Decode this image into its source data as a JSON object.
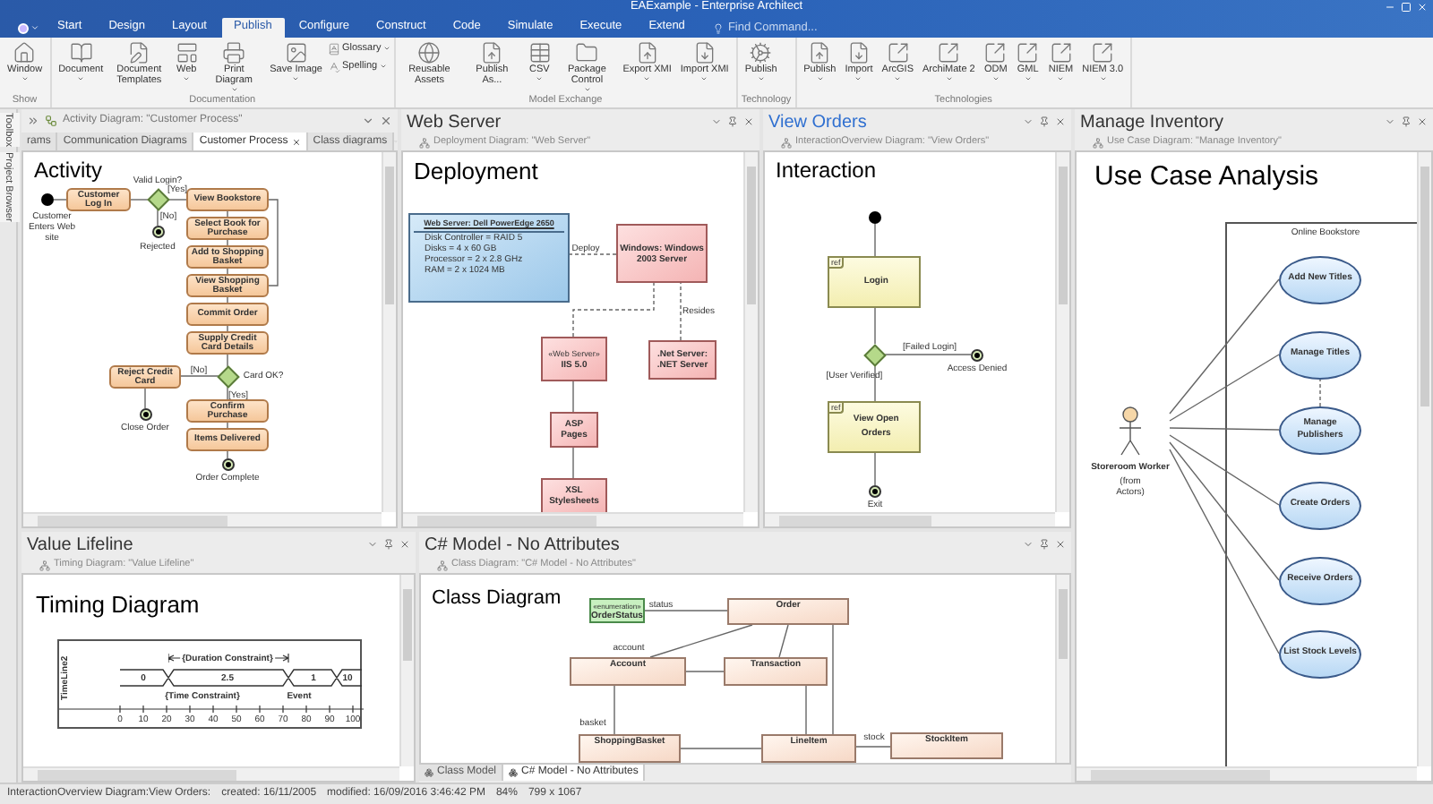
{
  "window": {
    "title": "EAExample - Enterprise Architect"
  },
  "ribbon_tabs": [
    {
      "label": "Start",
      "selected": false
    },
    {
      "label": "Design",
      "selected": false
    },
    {
      "label": "Layout",
      "selected": false
    },
    {
      "label": "Publish",
      "selected": true
    },
    {
      "label": "Configure",
      "selected": false
    },
    {
      "label": "Construct",
      "selected": false
    },
    {
      "label": "Code",
      "selected": false
    },
    {
      "label": "Simulate",
      "selected": false
    },
    {
      "label": "Execute",
      "selected": false
    },
    {
      "label": "Extend",
      "selected": false
    }
  ],
  "find_command": {
    "placeholder": "Find Command..."
  },
  "ribbon_groups": [
    {
      "label": "Show",
      "buttons": [
        {
          "kind": "large",
          "label": "Window",
          "dropdown": true
        }
      ]
    },
    {
      "label": "Documentation",
      "buttons": [
        {
          "kind": "large",
          "label": "Document",
          "dropdown": true
        },
        {
          "kind": "large",
          "label": "Document Templates",
          "dropdown": false
        },
        {
          "kind": "large",
          "label": "Web",
          "dropdown": true
        },
        {
          "kind": "large",
          "label": "Print Diagram",
          "dropdown": true
        },
        {
          "kind": "large",
          "label": "Save Image",
          "dropdown": true
        },
        {
          "kind": "small",
          "label": "Glossary",
          "dropdown": true
        },
        {
          "kind": "small",
          "label": "Spelling",
          "dropdown": true
        }
      ]
    },
    {
      "label": "Model Exchange",
      "buttons": [
        {
          "kind": "large",
          "label": "Reusable Assets",
          "dropdown": false
        },
        {
          "kind": "large",
          "label": "Publish As...",
          "dropdown": false
        },
        {
          "kind": "large",
          "label": "CSV",
          "dropdown": true
        },
        {
          "kind": "large",
          "label": "Package Control",
          "dropdown": true
        },
        {
          "kind": "large",
          "label": "Export XMI",
          "dropdown": true
        },
        {
          "kind": "large",
          "label": "Import XMI",
          "dropdown": true
        }
      ]
    },
    {
      "label": "Technology",
      "buttons": [
        {
          "kind": "large",
          "label": "Publish",
          "dropdown": true
        }
      ]
    },
    {
      "label": "Technologies",
      "buttons": [
        {
          "kind": "large",
          "label": "Publish",
          "dropdown": true
        },
        {
          "kind": "large",
          "label": "Import",
          "dropdown": true
        },
        {
          "kind": "large",
          "label": "ArcGIS",
          "dropdown": true
        },
        {
          "kind": "large",
          "label": "ArchiMate 2",
          "dropdown": true
        },
        {
          "kind": "large",
          "label": "ODM",
          "dropdown": true
        },
        {
          "kind": "large",
          "label": "GML",
          "dropdown": true
        },
        {
          "kind": "large",
          "label": "NIEM",
          "dropdown": true
        },
        {
          "kind": "large",
          "label": "NIEM 3.0",
          "dropdown": true
        }
      ]
    }
  ],
  "side_tabs": [
    "Toolbox",
    "Project Browser"
  ],
  "panels": [
    {
      "kind": "tabbed",
      "caption": "Activity Diagram: \"Customer Process\"",
      "tabs": [
        {
          "label": "rams",
          "selected": false
        },
        {
          "label": "Communication Diagrams",
          "selected": false
        },
        {
          "label": "Customer Process",
          "selected": true
        },
        {
          "label": "Class diagrams",
          "selected": false
        }
      ],
      "diagram": {
        "kind": "activity",
        "heading": "Activity",
        "actions": [
          "Customer Log In",
          "View Bookstore",
          "Select Book for Purchase",
          "Add to Shopping Basket",
          "View Shopping Basket",
          "Commit Order",
          "Supply Credit Card Details",
          "Reject Credit Card",
          "Confirm Purchase",
          "Items Delivered"
        ],
        "labels": [
          "Customer Enters Web site",
          "Valid Login?",
          "[Yes]",
          "[No]",
          "Rejected",
          "[No]",
          "Card OK?",
          "[Yes]",
          "Close Order",
          "Order Complete"
        ]
      }
    },
    {
      "kind": "titled",
      "title": "Web Server",
      "active": false,
      "caption": "Deployment Diagram: \"Web Server\"",
      "diagram": {
        "kind": "deployment",
        "heading": "Deployment",
        "nodes": [
          {
            "kind": "device",
            "label": "Web Server: Dell PowerEdge 2650",
            "attributes": [
              "Disk Controller = RAID 5",
              "Disks = 4 x 60 GB",
              "Processor = 2 x 2.8 GHz",
              "RAM = 2 x 1024 MB"
            ]
          },
          {
            "kind": "component",
            "label": "Windows: Windows 2003 Server"
          },
          {
            "kind": "component",
            "stereotype": "«Web Server»",
            "label": "IIS 5.0"
          },
          {
            "kind": "component",
            "label": ".Net Server: .NET Server"
          },
          {
            "kind": "component",
            "label": "ASP Pages"
          },
          {
            "kind": "component",
            "label": "XSL Stylesheets"
          }
        ],
        "labels": [
          "Deploy",
          "Resides"
        ]
      }
    },
    {
      "kind": "titled",
      "title": "View Orders",
      "active": true,
      "caption": "InteractionOverview Diagram: \"View Orders\"",
      "diagram": {
        "kind": "interaction",
        "heading": "Interaction",
        "refs": [
          {
            "tag": "ref",
            "label": "Login"
          },
          {
            "tag": "ref",
            "label": "View Open Orders"
          }
        ],
        "labels": [
          "[Failed Login]",
          "[User Verified]",
          "Access Denied",
          "Exit"
        ]
      }
    },
    {
      "kind": "titled",
      "title": "Manage Inventory",
      "active": false,
      "caption": "Use Case Diagram: \"Manage Inventory\"",
      "diagram": {
        "kind": "use_case",
        "heading": "Use Case Analysis",
        "boundary": "Online Bookstore",
        "use_cases": [
          "Add New Titles",
          "Manage Titles",
          "Manage Publishers",
          "Create Orders",
          "Receive Orders",
          "List Stock Levels"
        ],
        "actor": {
          "name": "Storeroom Worker",
          "note": "(from Actors)"
        }
      }
    },
    {
      "kind": "titled",
      "title": "Value Lifeline",
      "active": false,
      "caption": "Timing Diagram: \"Value Lifeline\"",
      "diagram": {
        "kind": "timing",
        "heading": "Timing Diagram",
        "lifeline": "TimeLine2",
        "states": [
          "0",
          "2.5",
          "1",
          "10"
        ],
        "duration_constraint": "{Duration Constraint}",
        "time_constraint": "{Time Constraint}",
        "event": "Event",
        "axis_ticks": [
          "0",
          "10",
          "20",
          "30",
          "40",
          "50",
          "60",
          "70",
          "80",
          "90",
          "100"
        ]
      }
    },
    {
      "kind": "titled",
      "title": "C# Model - No Attributes",
      "active": false,
      "caption": "Class Diagram: \"C# Model - No Attributes\"",
      "bottom_tabs": [
        {
          "label": "Class Model",
          "selected": false
        },
        {
          "label": "C# Model - No Attributes",
          "selected": true
        }
      ],
      "diagram": {
        "kind": "class",
        "heading": "Class Diagram",
        "classes": [
          {
            "kind": "enumeration",
            "stereotype": "«enumeration»",
            "name": "OrderStatus"
          },
          {
            "kind": "class",
            "name": "Order"
          },
          {
            "kind": "class",
            "name": "Account"
          },
          {
            "kind": "class",
            "name": "Transaction"
          },
          {
            "kind": "class",
            "name": "ShoppingBasket"
          },
          {
            "kind": "class",
            "name": "LineItem"
          },
          {
            "kind": "class",
            "name": "StockItem"
          }
        ],
        "labels": [
          "status",
          "account",
          "basket",
          "stock"
        ]
      }
    }
  ],
  "status_bar": [
    "InteractionOverview Diagram:View Orders:",
    "created: 16/11/2005",
    "modified: 16/09/2016 3:46:42 PM",
    "84%",
    "799 x 1067"
  ]
}
